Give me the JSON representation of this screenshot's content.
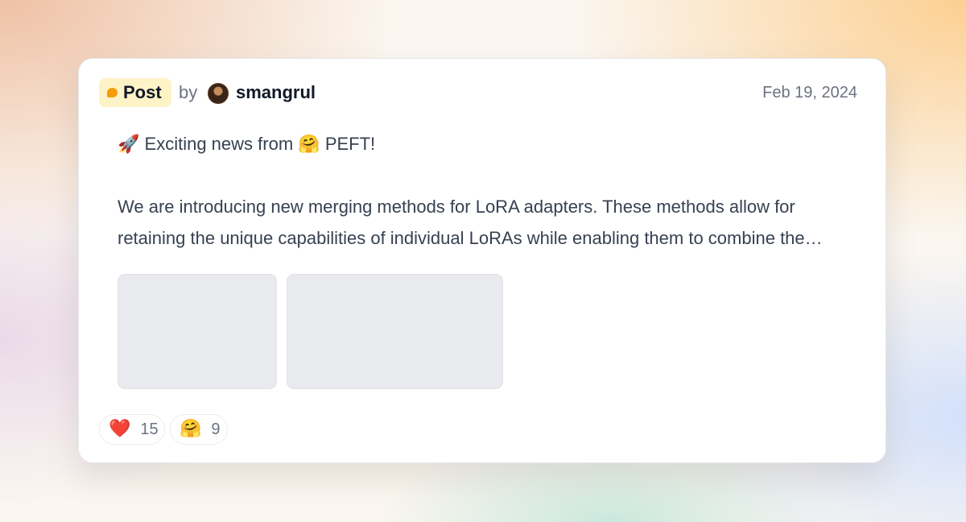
{
  "post": {
    "badge_label": "Post",
    "by_label": "by",
    "author": "smangrul",
    "date": "Feb 19, 2024",
    "line1_prefix": "Exciting news from",
    "line1_suffix": "PEFT!",
    "body_line1": "We are introducing new merging methods for LoRA adapters. These methods allow for",
    "body_line2": "retaining the unique capabilities of individual LoRAs while enabling them to combine the…",
    "rocket_emoji": "🚀",
    "hug_emoji": "🤗"
  },
  "reactions": [
    {
      "emoji": "❤️",
      "icon": "heart-icon",
      "count": "15"
    },
    {
      "emoji": "🤗",
      "icon": "hugging-face-icon",
      "count": "9"
    }
  ],
  "colors": {
    "badge_bg": "#fef3c7",
    "badge_dot": "#f59e0b",
    "thumbnail_bg": "#e9eaee"
  }
}
